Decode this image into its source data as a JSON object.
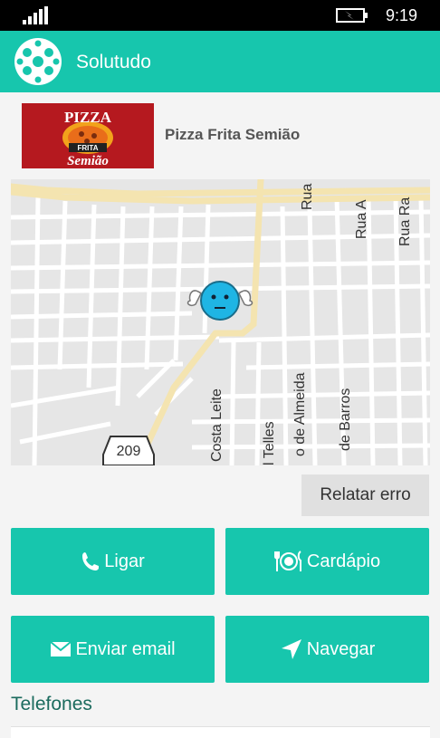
{
  "status_bar": {
    "time": "9:19",
    "signal_icon": "signal-bars-icon",
    "battery_icon": "battery-charging-icon"
  },
  "app_bar": {
    "title": "Solutudo",
    "logo_icon": "solutudo-logo-icon",
    "background": "#17c6ad"
  },
  "business": {
    "name": "Pizza Frita Semião",
    "logo_text_top": "PIZZA",
    "logo_text_mid": "FRITA",
    "logo_text_bottom": "Semião"
  },
  "map": {
    "street_labels": [
      "Rua",
      "Rua A",
      "Rua Ra",
      "Costa Leite",
      "l Telles",
      "o de Almeida",
      "de Barros"
    ],
    "route_shield": "209",
    "marker_icon": "winged-smiley-marker-icon"
  },
  "buttons": {
    "report_error": "Relatar erro",
    "call": "Ligar",
    "menu": "Cardápio",
    "send_email": "Enviar email",
    "navigate": "Navegar"
  },
  "sections": {
    "phones": "Telefones"
  },
  "colors": {
    "accent": "#17c6ad",
    "report_button": "#e0e0e0",
    "logo_red": "#b5191f"
  }
}
